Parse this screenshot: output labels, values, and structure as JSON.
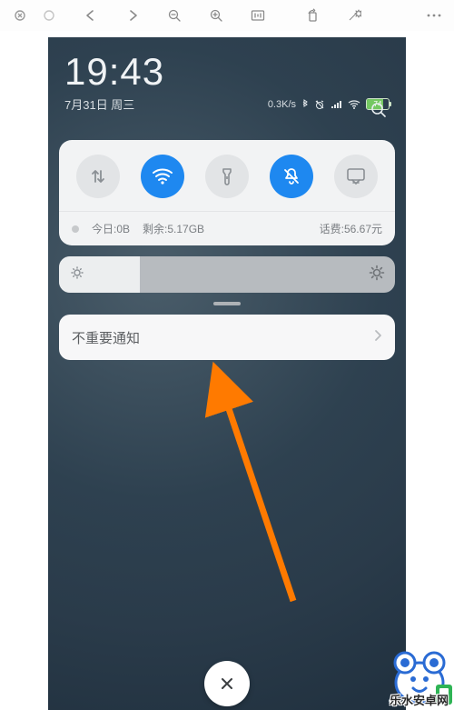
{
  "viewer": {
    "buttons": {
      "close": "close-icon",
      "stop": "stop-icon",
      "back": "arrow-left-icon",
      "forward": "arrow-right-icon",
      "zoom_out": "zoom-out-icon",
      "zoom_in": "zoom-in-icon",
      "actual_size": "one-to-one-icon",
      "rotate": "rotate-icon",
      "effects": "sparkle-icon",
      "more": "more-icon"
    }
  },
  "phone": {
    "clock": "19:43",
    "date": "7月31日 周三",
    "net_speed": "0.3K/s",
    "battery_percent": "74",
    "quick_settings": {
      "toggles": [
        {
          "name": "mobile-data",
          "active": false
        },
        {
          "name": "wifi",
          "active": true
        },
        {
          "name": "flashlight",
          "active": false
        },
        {
          "name": "dnd",
          "active": true
        },
        {
          "name": "screenshot",
          "active": false
        }
      ],
      "info_today_label": "今日:0B",
      "info_remaining_label": "剩余:5.17GB",
      "info_balance_label": "话费:56.67元"
    },
    "notification_title": "不重要通知"
  },
  "watermark_text": "乐水安卓网"
}
